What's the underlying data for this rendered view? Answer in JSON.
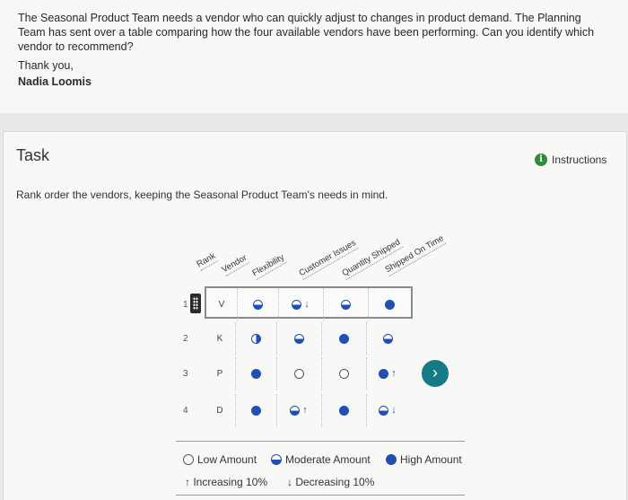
{
  "message": {
    "body": "The Seasonal Product Team needs a vendor who can quickly adjust to changes in product demand. The Planning Team has sent over a table comparing how the four available vendors have been performing. Can you identify which vendor to recommend?",
    "greeting": "Thank you,",
    "signature": "Nadia Loomis"
  },
  "task": {
    "title": "Task",
    "instructions_label": "Instructions",
    "prompt": "Rank order the vendors, keeping the Seasonal Product Team's needs in mind."
  },
  "table": {
    "headers": [
      "Rank",
      "Vendor",
      "Flexibility",
      "Customer Issues",
      "Quantity Shipped",
      "Shipped On Time"
    ],
    "rows": [
      {
        "rank": "1",
        "vendor": "V",
        "flexibility": "moderate",
        "flex_arrow": "",
        "issues": "moderate",
        "issues_arrow": "↓",
        "quantity": "moderate",
        "quantity_arrow": "",
        "ontime": "high",
        "ontime_arrow": ""
      },
      {
        "rank": "2",
        "vendor": "K",
        "flexibility": "moderate-v",
        "flex_arrow": "",
        "issues": "moderate-v",
        "issues_arrow": "",
        "quantity": "high",
        "quantity_arrow": "",
        "ontime": "moderate",
        "ontime_arrow": ""
      },
      {
        "rank": "3",
        "vendor": "P",
        "flexibility": "high",
        "flex_arrow": "",
        "issues": "low",
        "issues_arrow": "",
        "quantity": "low",
        "quantity_arrow": "",
        "ontime": "high",
        "ontime_arrow": "↑"
      },
      {
        "rank": "4",
        "vendor": "D",
        "flexibility": "high",
        "flex_arrow": "",
        "issues": "moderate",
        "issues_arrow": "↑",
        "quantity": "high",
        "quantity_arrow": "",
        "ontime": "moderate",
        "ontime_arrow": "↓"
      }
    ]
  },
  "next_button": {
    "label": "›"
  },
  "legend": {
    "low": "Low Amount",
    "moderate": "Moderate Amount",
    "high": "High Amount",
    "increasing": "↑ Increasing 10%",
    "decreasing": "↓ Decreasing 10%"
  },
  "colors": {
    "accent": "#1f4fb2",
    "next_button": "#147a86",
    "info_icon": "#2e8b3e"
  }
}
